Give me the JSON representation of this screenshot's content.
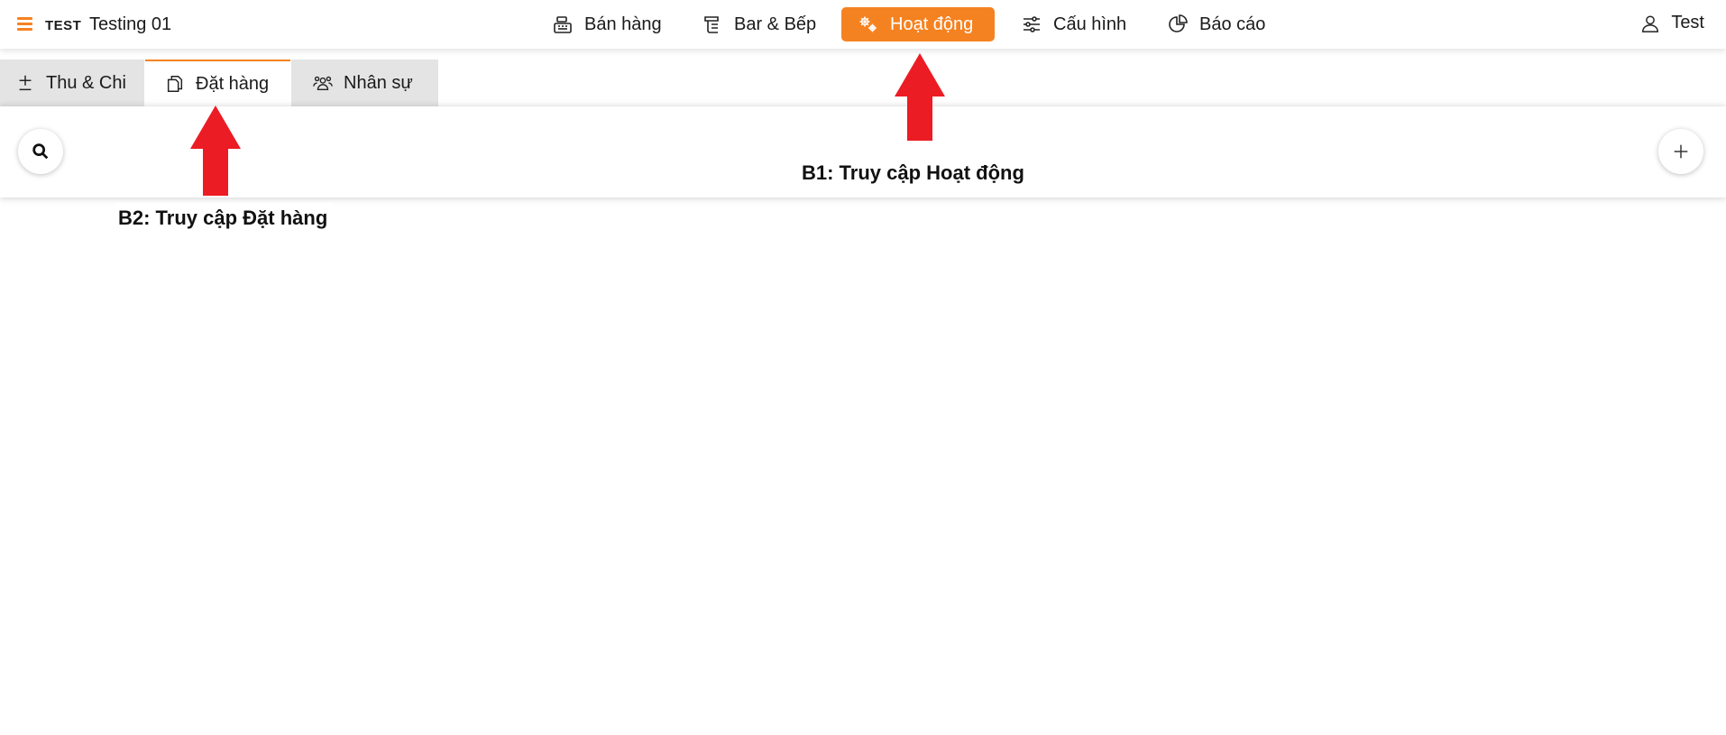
{
  "header": {
    "brand": "TEST",
    "store_name": "Testing 01",
    "nav": [
      {
        "label": "Bán hàng",
        "icon": "cash-register-icon"
      },
      {
        "label": "Bar & Bếp",
        "icon": "kitchen-icon"
      },
      {
        "label": "Hoạt động",
        "icon": "gears-icon",
        "active": true
      },
      {
        "label": "Cấu hình",
        "icon": "sliders-icon"
      },
      {
        "label": "Báo cáo",
        "icon": "pie-chart-icon"
      }
    ],
    "user_label": "Test"
  },
  "tabs": [
    {
      "label": "Thu & Chi",
      "icon": "plus-minus-icon"
    },
    {
      "label": "Đặt hàng",
      "icon": "documents-icon",
      "active": true
    },
    {
      "label": "Nhân sự",
      "icon": "users-icon"
    }
  ],
  "annotations": {
    "step1": "B1: Truy cập Hoạt động",
    "step2": "B2: Truy cập Đặt hàng"
  },
  "colors": {
    "accent": "#f58220",
    "arrow": "#ec1c24",
    "tab_inactive": "#e4e4e4"
  }
}
